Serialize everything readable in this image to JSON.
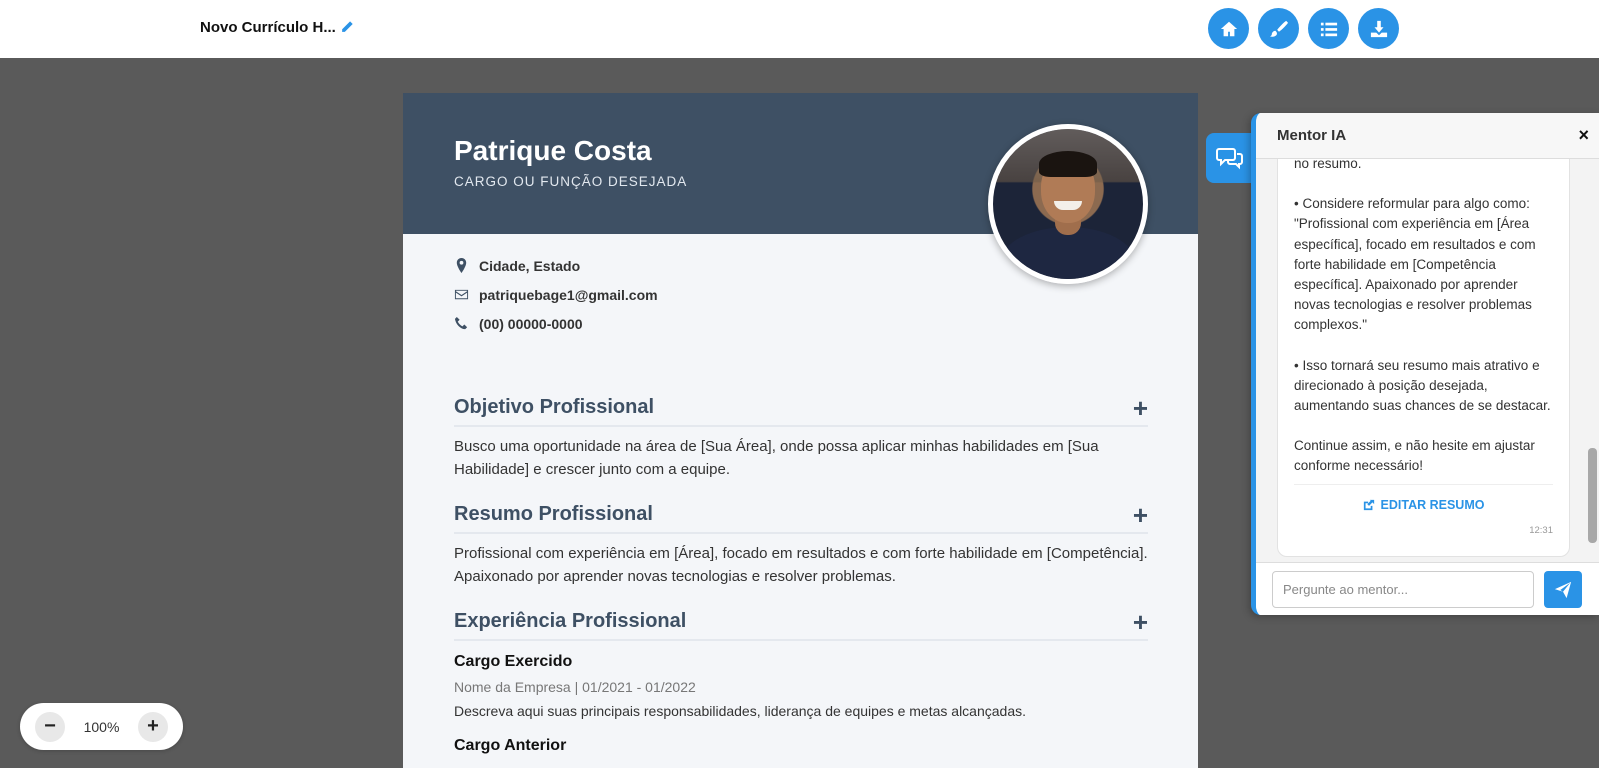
{
  "header": {
    "doc_title": "Novo Currículo H...",
    "icons": [
      "home-icon",
      "brush-icon",
      "list-icon",
      "download-icon"
    ]
  },
  "resume": {
    "name": "Patrique Costa",
    "role": "CARGO OU FUNÇÃO DESEJADA",
    "contacts": {
      "location": "Cidade, Estado",
      "email": "patriquebage1@gmail.com",
      "phone": "(00) 00000-0000"
    },
    "sections": [
      {
        "title": "Objetivo Profissional",
        "body": "Busco uma oportunidade na área de [Sua Área], onde possa aplicar minhas habilidades em [Sua Habilidade] e crescer junto com a equipe."
      },
      {
        "title": "Resumo Profissional",
        "body": "Profissional com experiência em [Área], focado em resultados e com forte habilidade em [Competência]. Apaixonado por aprender novas tecnologias e resolver problemas."
      },
      {
        "title": "Experiência Profissional"
      }
    ],
    "jobs": [
      {
        "title": "Cargo Exercido",
        "meta": "Nome da Empresa | 01/2021 - 01/2022",
        "desc": "Descreva aqui suas principais responsabilidades, liderança de equipes e metas alcançadas."
      },
      {
        "title": "Cargo Anterior"
      }
    ]
  },
  "zoom": {
    "minus": "−",
    "value": "100%",
    "plus": "+"
  },
  "mentor": {
    "title": "Mentor IA",
    "close": "×",
    "message": {
      "partial_top": "no resumo.",
      "p1": "• Considere reformular para algo como: \"Profissional com experiência em [Área específica], focado em resultados e com forte habilidade em [Competência específica]. Apaixonado por aprender novas tecnologias e resolver problemas complexos.\"",
      "p2": "• Isso tornará seu resumo mais atrativo e direcionado à posição desejada, aumentando suas chances de se destacar.",
      "p3": "Continue assim, e não hesite em ajustar conforme necessário!",
      "action": "EDITAR RESUMO",
      "time": "12:31"
    },
    "input_placeholder": "Pergunte ao mentor..."
  },
  "colors": {
    "accent": "#2a93e6",
    "header_bg": "#3e5064",
    "backdrop": "#5a5a5a"
  }
}
